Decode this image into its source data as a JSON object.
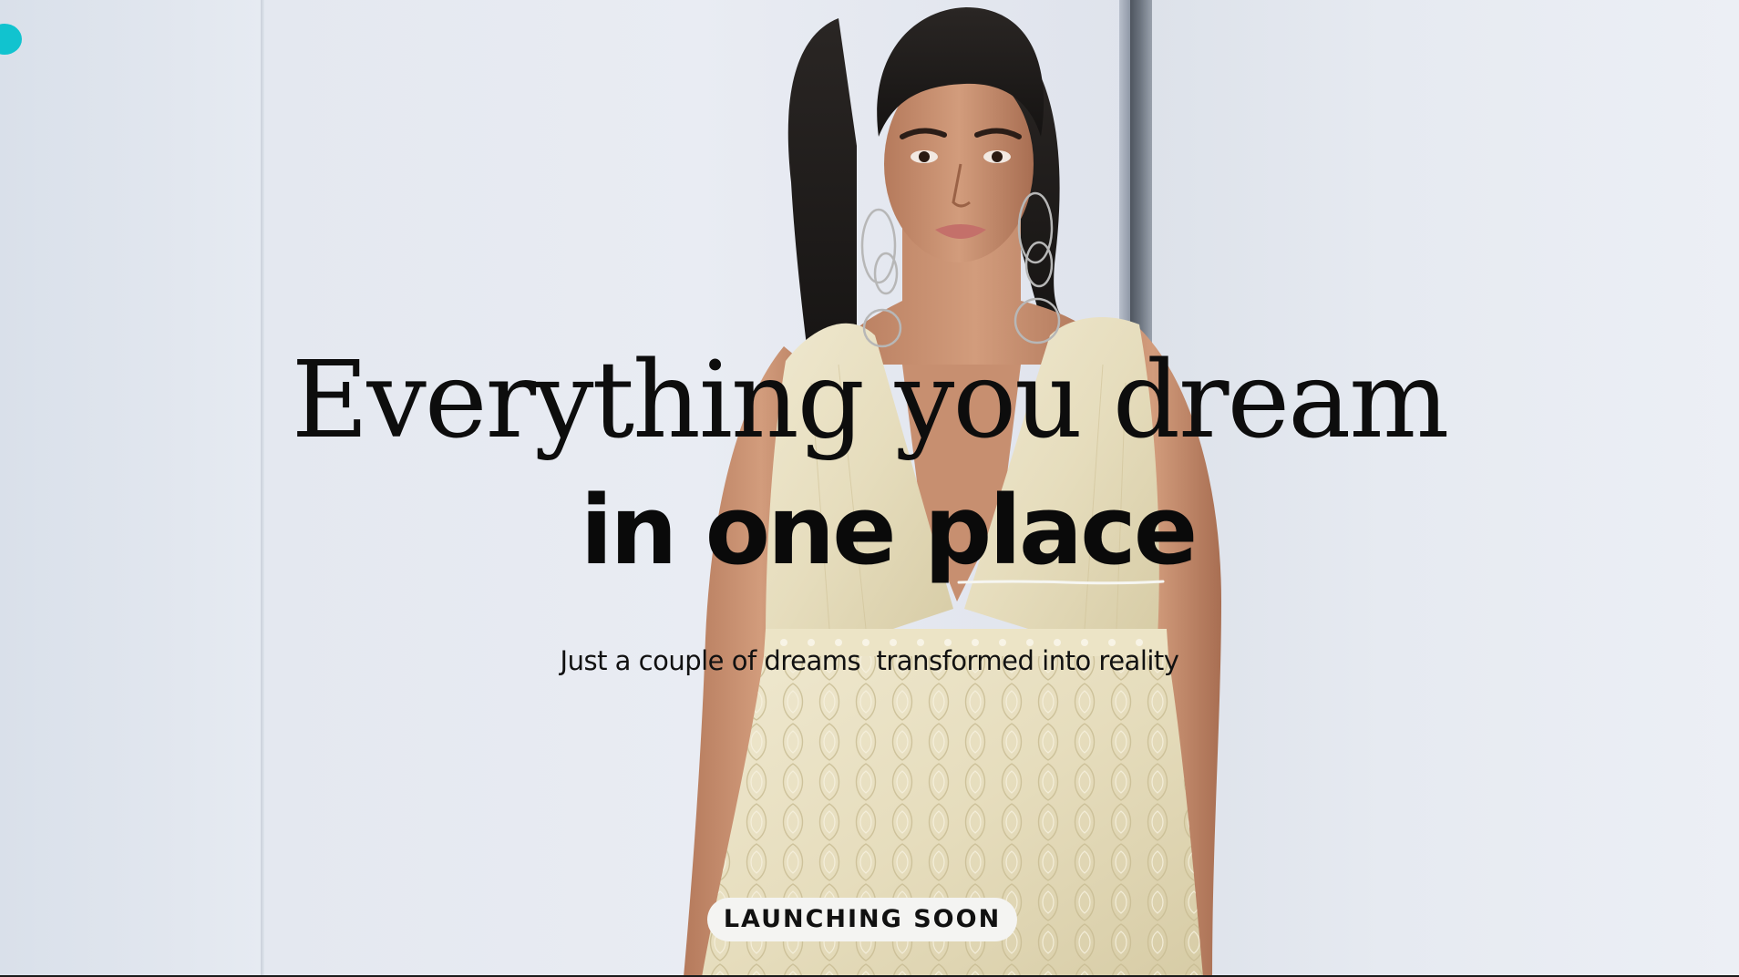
{
  "hero": {
    "headline_line1": "Everything you dream",
    "headline_line2": "in one place",
    "tagline": "Just a couple of dreams  transformed into reality",
    "cta_label": "LAUNCHING SOON"
  },
  "colors": {
    "cursor_dot": "#11c3cf",
    "text": "#0d0d0d",
    "cta_background": "#f4f4f2"
  },
  "icons": {
    "cursor": "cursor-dot-icon"
  }
}
